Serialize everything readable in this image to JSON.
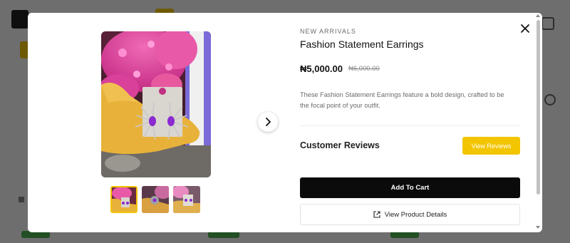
{
  "product": {
    "category": "NEW ARRIVALS",
    "title": "Fashion Statement Earrings",
    "price": "₦5,000.00",
    "old_price": "₦6,000.00",
    "description": "These Fashion Statement Earrings feature a bold design, crafted to be the focal point of your outfit."
  },
  "reviews": {
    "title": "Customer Reviews",
    "button_label": "View Reviews"
  },
  "actions": {
    "add_to_cart": "Add To Cart",
    "view_details": "View Product Details"
  },
  "gallery": {
    "thumbnail_count": 3,
    "active_index": 0
  },
  "icons": {
    "close": "close-icon",
    "next": "chevron-right-icon",
    "external": "external-link-icon"
  },
  "colors": {
    "accent": "#f2c500",
    "primary_button": "#0b0b0b",
    "overlay": "#000000"
  }
}
